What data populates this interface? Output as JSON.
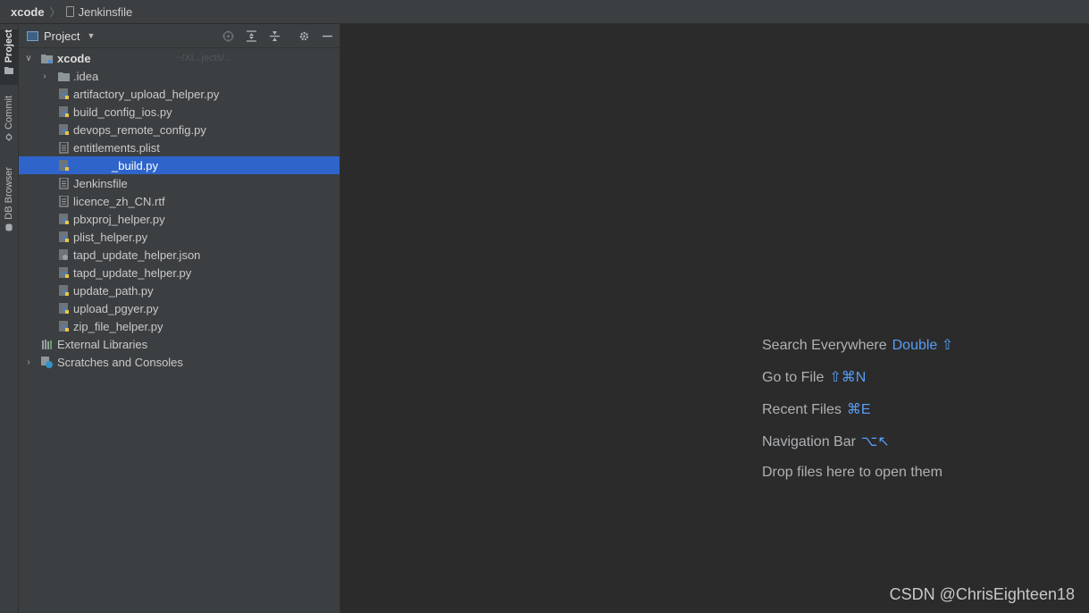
{
  "breadcrumb": {
    "root": "xcode",
    "file": "Jenkinsfile"
  },
  "tool_windows": {
    "project": "Project",
    "commit": "Commit",
    "db_browser": "DB Browser"
  },
  "project_panel": {
    "title": "Project",
    "root_label": "xcode",
    "root_hint": "~/Xi...jects/..",
    "items": [
      {
        "label": ".idea",
        "icon": "folder-icon"
      },
      {
        "label": "artifactory_upload_helper.py",
        "icon": "python-file-icon"
      },
      {
        "label": "build_config_ios.py",
        "icon": "python-file-icon"
      },
      {
        "label": "devops_remote_config.py",
        "icon": "python-file-icon"
      },
      {
        "label": "entitlements.plist",
        "icon": "text-file-icon"
      },
      {
        "label": "_build.py",
        "icon": "python-file-icon"
      },
      {
        "label": "Jenkinsfile",
        "icon": "text-file-icon"
      },
      {
        "label": "licence_zh_CN.rtf",
        "icon": "text-file-icon"
      },
      {
        "label": "pbxproj_helper.py",
        "icon": "python-file-icon"
      },
      {
        "label": "plist_helper.py",
        "icon": "python-file-icon"
      },
      {
        "label": "tapd_update_helper.json",
        "icon": "json-file-icon"
      },
      {
        "label": "tapd_update_helper.py",
        "icon": "python-file-icon"
      },
      {
        "label": "update_path.py",
        "icon": "python-file-icon"
      },
      {
        "label": "upload_pgyer.py",
        "icon": "python-file-icon"
      },
      {
        "label": "zip_file_helper.py",
        "icon": "python-file-icon"
      }
    ],
    "external_libraries": "External Libraries",
    "scratches": "Scratches and Consoles",
    "selected_index": 5
  },
  "editor_hints": [
    {
      "label": "Search Everywhere",
      "shortcut": "Double ⇧"
    },
    {
      "label": "Go to File",
      "shortcut": "⇧⌘N"
    },
    {
      "label": "Recent Files",
      "shortcut": "⌘E"
    },
    {
      "label": "Navigation Bar",
      "shortcut": "⌥↖"
    },
    {
      "label": "Drop files here to open them",
      "shortcut": ""
    }
  ],
  "watermark": "CSDN @ChrisEighteen18",
  "colors": {
    "selection": "#2f65ca",
    "shortcut": "#589df6",
    "panel_bg": "#3c3f41",
    "editor_bg": "#2b2b2b"
  }
}
